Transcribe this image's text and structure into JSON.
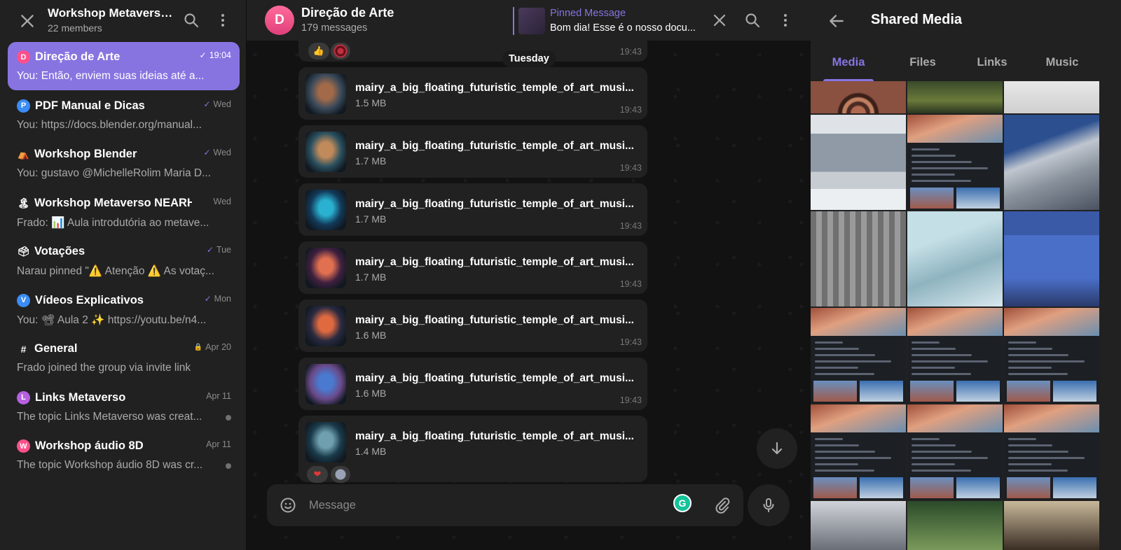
{
  "sidebar": {
    "title": "Workshop Metaverso ...",
    "members": "22 members",
    "chats": [
      {
        "name": "Direção de Arte",
        "badge": "D",
        "badge_color": "#ff4f8b",
        "time": "19:04",
        "check": "✓",
        "preview": "You: Então, enviem suas ideias até a...",
        "active": true
      },
      {
        "name": "PDF Manual e Dicas",
        "badge": "P",
        "badge_color": "#3b8cf5",
        "time": "Wed",
        "check": "✓",
        "preview": "You: https://docs.blender.org/manual..."
      },
      {
        "name": "Workshop Blender",
        "emoji": "⛺",
        "time": "Wed",
        "check": "✓",
        "preview": "You: gustavo @MichelleRolim Maria D..."
      },
      {
        "name": "Workshop Metaverso NEARHu...",
        "emoji": "🏝",
        "time": "Wed",
        "preview": "Frado: 📊 Aula introdutória ao metave..."
      },
      {
        "name": "Votações",
        "emoji": "🗳",
        "time": "Tue",
        "check": "✓",
        "preview": "Narau pinned \"⚠️ Atenção ⚠️ As votaç..."
      },
      {
        "name": "Vídeos Explicativos",
        "badge": "V",
        "badge_color": "#3b8cf5",
        "time": "Mon",
        "check": "✓",
        "preview": "You: 📽 Aula 2 ✨ https://youtu.be/n4..."
      },
      {
        "name": "General",
        "hash": "#",
        "time": "Apr 20",
        "lock": "🔒",
        "preview": "Frado joined the group via invite link"
      },
      {
        "name": "Links Metaverso",
        "badge": "L",
        "badge_color": "#b660e0",
        "time": "Apr 11",
        "preview": "The topic Links Metaverso was creat...",
        "dot": true
      },
      {
        "name": "Workshop áudio 8D",
        "badge": "W",
        "badge_color": "#ff4f8b",
        "time": "Apr 11",
        "preview": "The topic Workshop áudio 8D was cr...",
        "dot": true
      }
    ]
  },
  "chat": {
    "avatar_letter": "D",
    "title": "Direção de Arte",
    "subtitle": "179 messages",
    "pinned": {
      "title": "Pinned Message",
      "text": "Bom dia! Esse é o nosso docu..."
    },
    "date_pill": "Tuesday",
    "first_time": "19:43",
    "messages": [
      {
        "name": "mairy_a_big_floating_futuristic_temple_of_art_musi...",
        "size": "1.5 MB",
        "time": "19:43",
        "thumb": [
          "#3a4a5a",
          "#a36a4a"
        ]
      },
      {
        "name": "mairy_a_big_floating_futuristic_temple_of_art_musi...",
        "size": "1.7 MB",
        "time": "19:43",
        "thumb": [
          "#2a5060",
          "#c08a5a"
        ]
      },
      {
        "name": "mairy_a_big_floating_futuristic_temple_of_art_musi...",
        "size": "1.7 MB",
        "time": "19:43",
        "thumb": [
          "#123a5a",
          "#2ab0d0"
        ]
      },
      {
        "name": "mairy_a_big_floating_futuristic_temple_of_art_musi...",
        "size": "1.7 MB",
        "time": "19:43",
        "thumb": [
          "#402040",
          "#e07050"
        ]
      },
      {
        "name": "mairy_a_big_floating_futuristic_temple_of_art_musi...",
        "size": "1.6 MB",
        "time": "19:43",
        "thumb": [
          "#2a2a40",
          "#e06a40"
        ]
      },
      {
        "name": "mairy_a_big_floating_futuristic_temple_of_art_musi...",
        "size": "1.6 MB",
        "time": "19:43",
        "thumb": [
          "#6a4a8a",
          "#4a7ad0"
        ]
      },
      {
        "name": "mairy_a_big_floating_futuristic_temple_of_art_musi...",
        "size": "1.4 MB",
        "time": "",
        "thumb": [
          "#1a3a4a",
          "#70a0b0"
        ]
      }
    ],
    "composer_placeholder": "Message"
  },
  "media_panel": {
    "title": "Shared Media",
    "tabs": [
      "Media",
      "Files",
      "Links",
      "Music"
    ],
    "active_tab": "Media"
  },
  "colors": {
    "accent": "#8774e1",
    "panel": "#212121",
    "background": "#0f0f0f"
  }
}
